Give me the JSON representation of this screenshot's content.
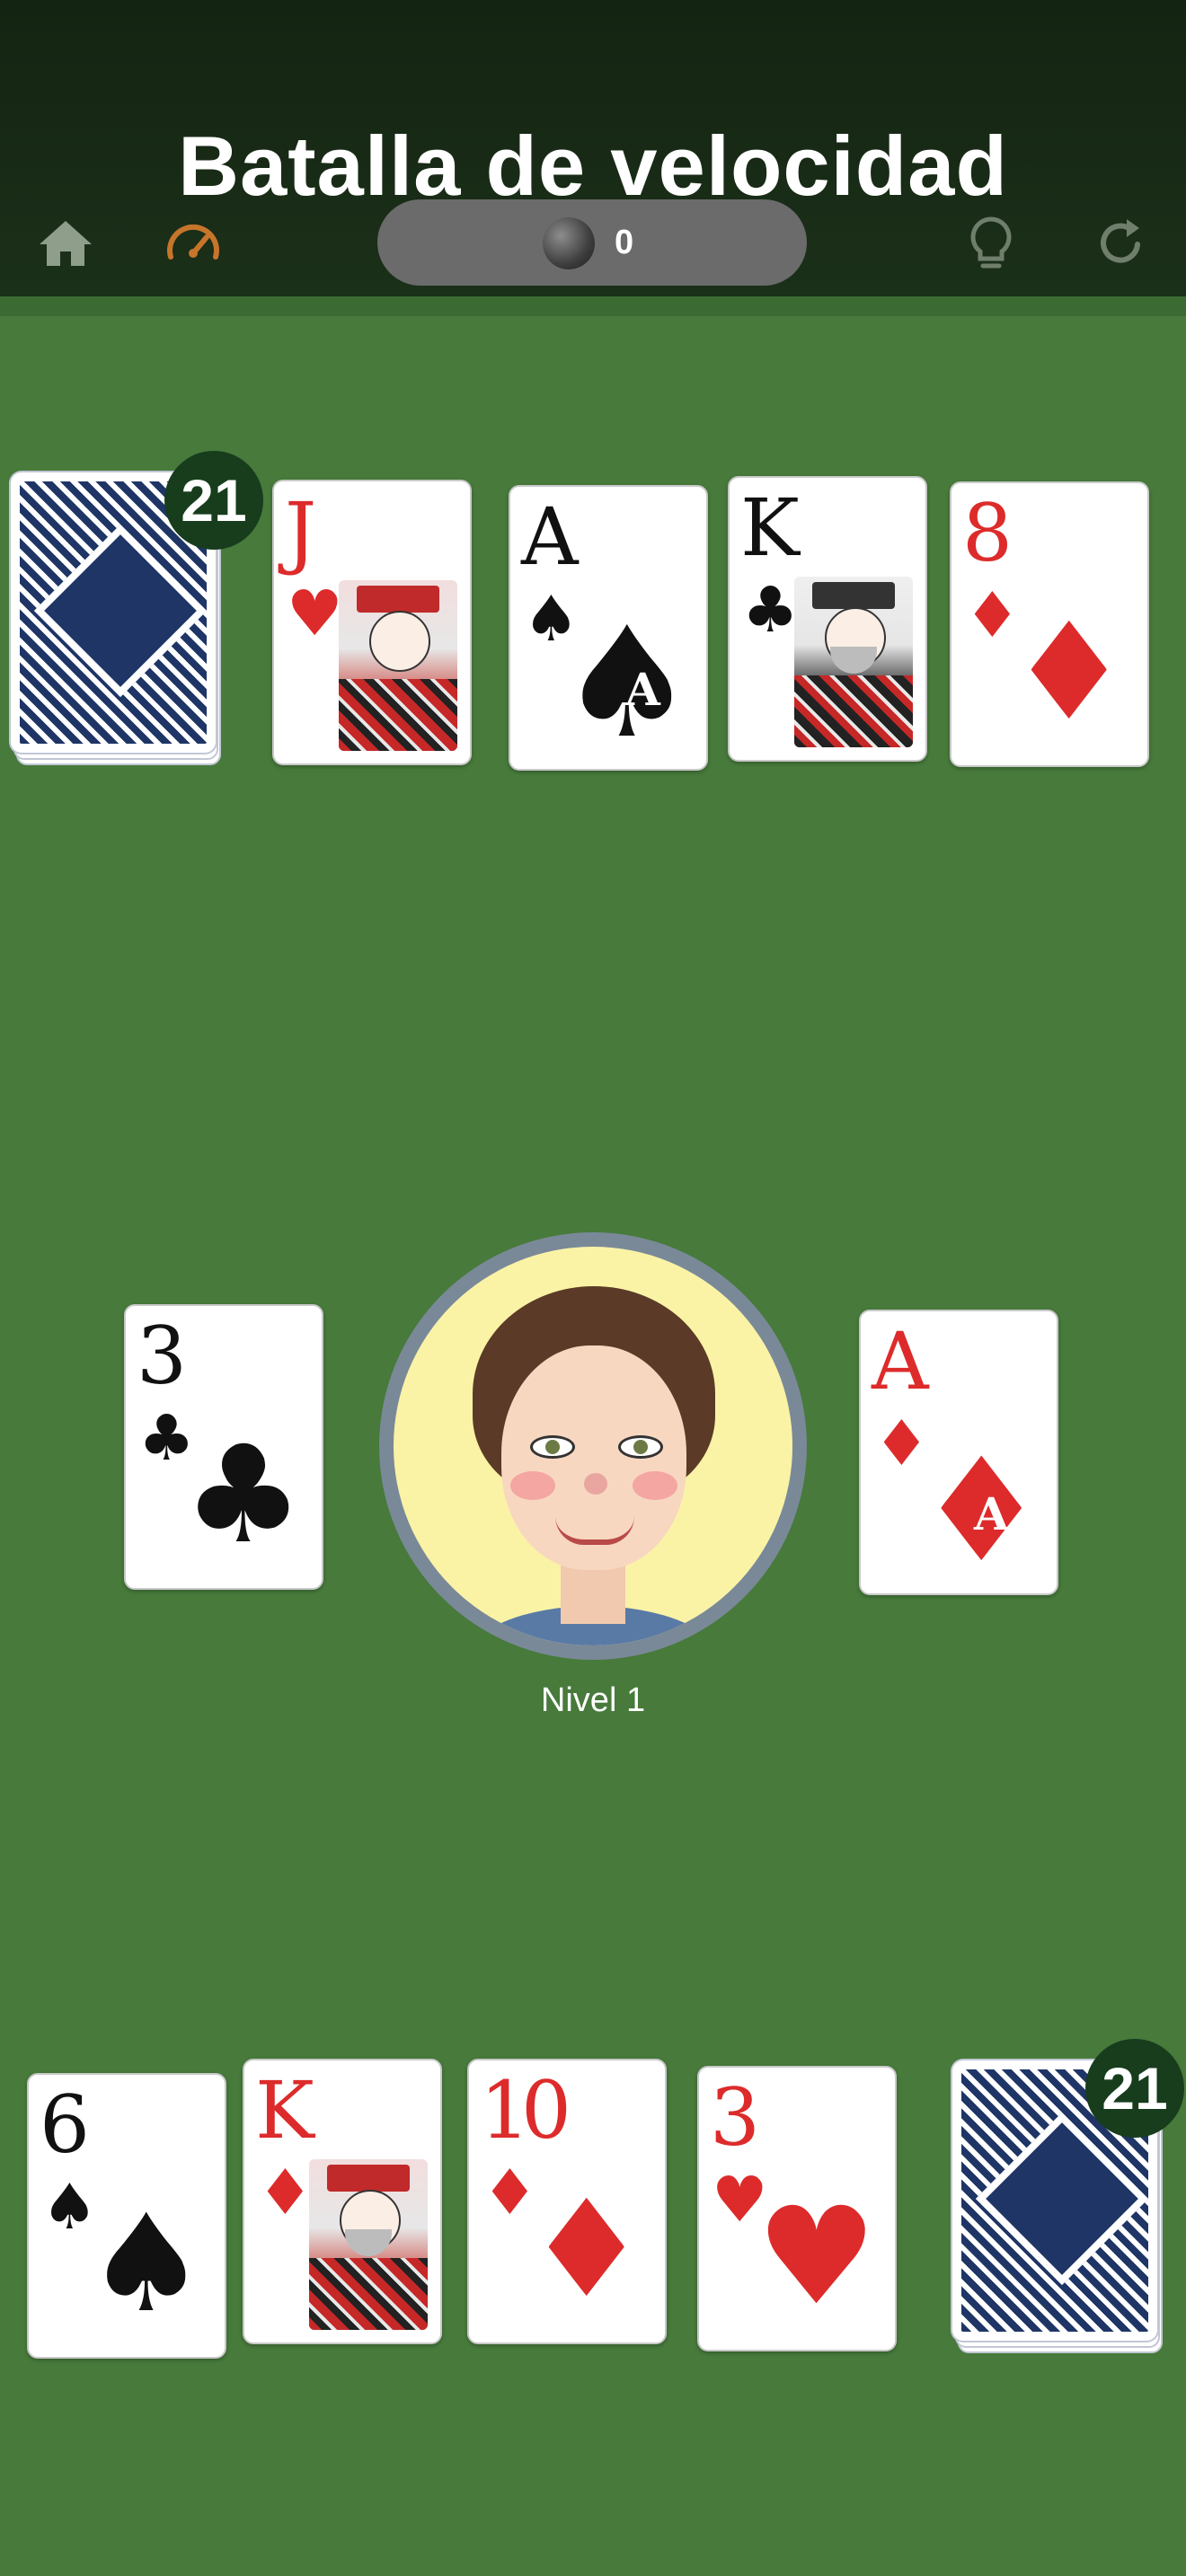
{
  "header": {
    "title": "Batalla de velocidad",
    "score": "0",
    "icons": [
      "home-icon",
      "speedometer-icon",
      "lightbulb-icon",
      "refresh-icon"
    ]
  },
  "opponent": {
    "deck_count": "21",
    "cards": [
      {
        "rank": "J",
        "suit": "♥",
        "color": "red"
      },
      {
        "rank": "A",
        "suit": "♠",
        "color": "black"
      },
      {
        "rank": "K",
        "suit": "♣",
        "color": "black"
      },
      {
        "rank": "8",
        "suit": "♦",
        "color": "red"
      }
    ]
  },
  "center": {
    "left_pile": {
      "rank": "3",
      "suit": "♣",
      "color": "black"
    },
    "right_pile": {
      "rank": "A",
      "suit": "♦",
      "color": "red"
    },
    "ace_left_letter": "A",
    "ace_right_letter": "A",
    "level": "Nivel 1"
  },
  "player": {
    "deck_count": "21",
    "cards": [
      {
        "rank": "6",
        "suit": "♠",
        "color": "black"
      },
      {
        "rank": "K",
        "suit": "♦",
        "color": "red"
      },
      {
        "rank": "10",
        "suit": "♦",
        "color": "red"
      },
      {
        "rank": "3",
        "suit": "♥",
        "color": "red"
      }
    ]
  },
  "colors": {
    "table": "#477a3b",
    "header": "#172a15",
    "red": "#dd2b2b",
    "card_back": "#1e3566",
    "badge": "#173d1d"
  }
}
